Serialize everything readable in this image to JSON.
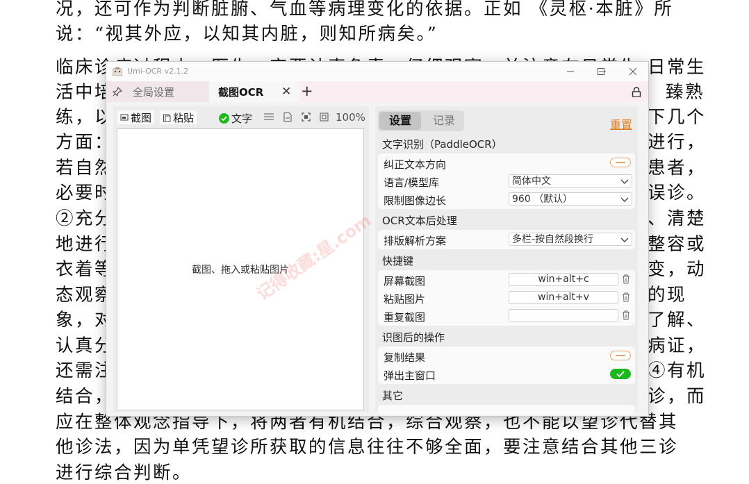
{
  "document": {
    "lines": [
      "况，还可作为判断脏腑、气血等病理变化的依据。正如 《灵枢·本脏》所",
      "说：“视其外应，以知其内脏，则知所病矣。”",
      "    临床诊疗过程中，医生一定要认真负责，仔细观察，并注意在日常生",
      "活中培",
      "练，以",
      "方面：",
      "若自然",
      "必要时",
      "②充分",
      "地进行",
      "衣着等",
      "态观察",
      "象，对",
      "认真分",
      "还需注",
      "结合，",
      "应在整体观念指导下，将两者有机结合，综合观察，也不能以望诊代替其",
      "他诊法，因为单凭望诊所获取的信息往往不够全面，要注意结合其他三诊",
      "进行综合判断。"
    ],
    "right_fragments": [
      "日常生",
      "臻熟",
      "下几个",
      "进行，",
      "患者，",
      "误诊。",
      "、清楚",
      "整容或",
      "变，动",
      "的现",
      "了解、",
      "病证，",
      "④有机",
      "诊，而"
    ]
  },
  "window": {
    "title": "Umi-OCR v2.1.2",
    "controls": {
      "minimize": "—",
      "maximize": "☐",
      "close": "✕"
    },
    "tabs": {
      "global": "全局设置",
      "ocr": "截图OCR",
      "close": "✕",
      "add": "+"
    }
  },
  "left": {
    "screenshot": "截图",
    "paste": "粘贴",
    "text_toggle": "文字",
    "zoom": "100%",
    "hint": "截图、拖入或粘贴图片"
  },
  "right": {
    "tab_settings": "设置",
    "tab_records": "记录",
    "reset": "重置",
    "sec_text": "文字识别（PaddleOCR）",
    "correct_dir": "纠正文本方向",
    "language": "语言/模型库",
    "language_value": "简体中文",
    "limit": "限制图像边长",
    "limit_value": "960 （默认）",
    "sec_post": "OCR文本后处理",
    "layout": "排版解析方案",
    "layout_value": "多栏-按自然段换行",
    "sec_hotkey": "快捷键",
    "hk_screen": "屏幕截图",
    "hk_screen_value": "win+alt+c",
    "hk_paste": "粘贴图片",
    "hk_paste_value": "win+alt+v",
    "hk_repeat": "重复截图",
    "hk_repeat_value": "",
    "sec_after": "识图后的操作",
    "copy": "复制结果",
    "popup": "弹出主窗口",
    "sec_other": "其它"
  },
  "watermark": "记得收藏:星.com",
  "colors": {
    "accent_orange": "#e07b1b",
    "toggle_green": "#1db81d",
    "tab_bar": "#faeef2"
  }
}
